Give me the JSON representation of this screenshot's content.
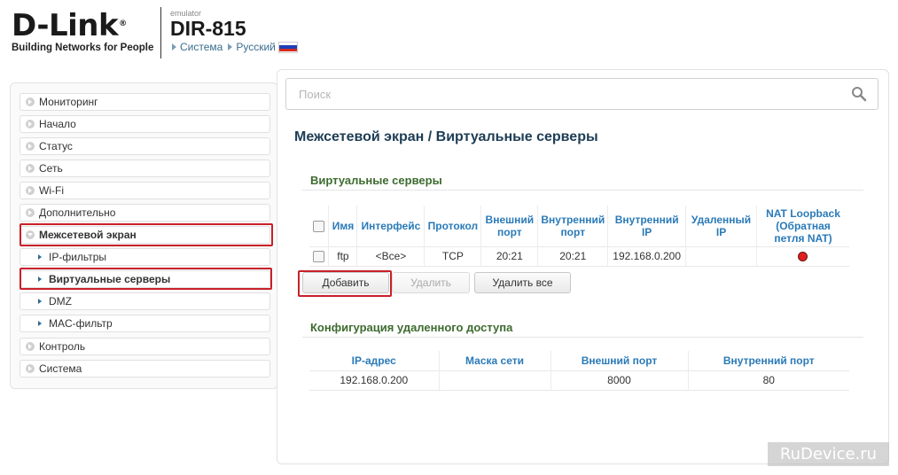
{
  "header": {
    "logo_text": "D-Link",
    "logo_reg": "®",
    "tagline": "Building Networks for People",
    "emulator": "emulator",
    "model": "DIR-815",
    "crumb_system": "Система",
    "crumb_language": "Русский",
    "flag_colors": [
      "#ffffff",
      "#1f3fb8",
      "#d52b1e"
    ]
  },
  "sidebar": {
    "items": [
      {
        "label": "Мониторинг"
      },
      {
        "label": "Начало"
      },
      {
        "label": "Статус"
      },
      {
        "label": "Сеть"
      },
      {
        "label": "Wi-Fi"
      },
      {
        "label": "Дополнительно"
      },
      {
        "label": "Межсетевой экран"
      },
      {
        "label": "IP-фильтры"
      },
      {
        "label": "Виртуальные серверы"
      },
      {
        "label": "DMZ"
      },
      {
        "label": "MAC-фильтр"
      },
      {
        "label": "Контроль"
      },
      {
        "label": "Система"
      }
    ]
  },
  "search": {
    "placeholder": "Поиск"
  },
  "page": {
    "title": "Межсетевой экран /  Виртуальные серверы"
  },
  "virtual_servers": {
    "title": "Виртуальные серверы",
    "columns": [
      "Имя",
      "Интерфейс",
      "Протокол",
      "Внешний порт",
      "Внутренний порт",
      "Внутренний IP",
      "Удаленный IP",
      "NAT Loopback (Обратная петля NAT)"
    ],
    "rows": [
      {
        "name": "ftp",
        "interface": "<Все>",
        "protocol": "TCP",
        "ext_port": "20:21",
        "int_port": "20:21",
        "int_ip": "192.168.0.200",
        "remote_ip": "",
        "nat_loopback": "off"
      }
    ],
    "buttons": {
      "add": "Добавить",
      "delete": "Удалить",
      "delete_all": "Удалить все"
    }
  },
  "remote_access": {
    "title": "Конфигурация удаленного доступа",
    "columns": [
      "IP-адрес",
      "Маска сети",
      "Внешний порт",
      "Внутренний порт"
    ],
    "rows": [
      {
        "ip": "192.168.0.200",
        "mask": "",
        "ext_port": "8000",
        "int_port": "80"
      }
    ]
  },
  "watermark": "RuDevice.ru",
  "colors": {
    "highlight": "#c8202a",
    "header_text": "#2a7ab8",
    "section_title": "#3d6b2f",
    "status_off": "#e02020"
  }
}
